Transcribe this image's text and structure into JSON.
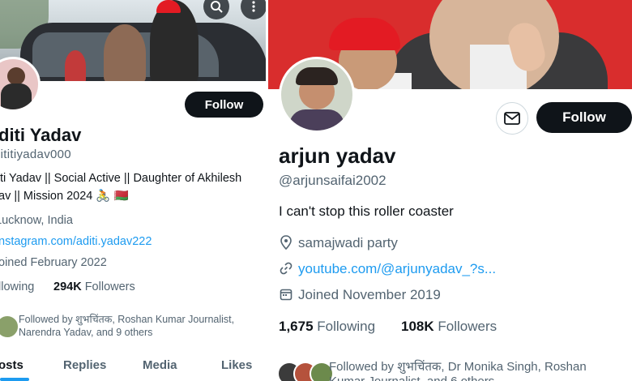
{
  "left_profile": {
    "follow_label": "Follow",
    "name": "diti Yadav",
    "handle": "dititiyadav000",
    "bio_line1": "ti Yadav || Social Active ||  Daughter of Akhilesh",
    "bio_line2": "av || Mission 2024 🚴 🇧🇾",
    "location": "Lucknow, India",
    "website": "nstagram.com/aditi.yadav222",
    "joined": "oined February 2022",
    "following_label": "llowing",
    "followers_count": "294K",
    "followers_label": "Followers",
    "followed_by_line1": "Followed by शुभचिंतक, Roshan Kumar Journalist,",
    "followed_by_line2": "Narendra Yadav, and 9 others",
    "tabs": [
      "osts",
      "Replies",
      "Media",
      "Likes"
    ]
  },
  "right_profile": {
    "follow_label": "Follow",
    "name": "arjun yadav",
    "handle": "@arjunsaifai2002",
    "bio": "I can't stop this roller coaster",
    "location": "samajwadi party",
    "website": "youtube.com/@arjunyadav_?s...",
    "joined": "Joined November 2019",
    "following_count": "1,675",
    "following_label": "Following",
    "followers_count": "108K",
    "followers_label": "Followers",
    "followed_by_line1": "Followed by शुभचिंतक, Dr Monika Singh, Roshan",
    "followed_by_line2": "Kumar Journalist, and 6 others"
  },
  "icons": {
    "search": "search-icon",
    "more": "more-icon",
    "mail": "mail-icon",
    "location": "location-pin-icon",
    "link": "link-icon",
    "calendar": "calendar-icon"
  },
  "colors": {
    "link": "#1d9bf0",
    "muted": "#536471",
    "button": "#0f1419",
    "banner_red": "#d92d2d"
  }
}
